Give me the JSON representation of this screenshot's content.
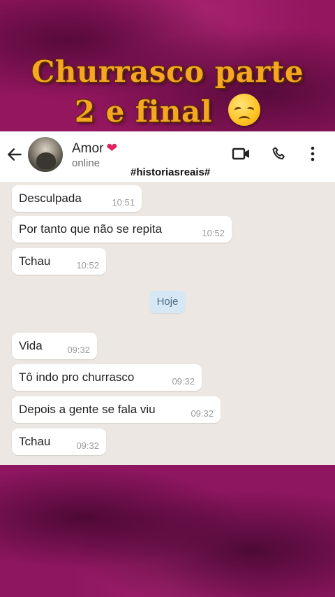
{
  "overlay": {
    "title_line1": "Churrasco parte",
    "title_line2": "2 e final",
    "title_emoji": "disappointed-face-emoji"
  },
  "header": {
    "contact_name": "Amor",
    "heart": "❤",
    "status": "online",
    "hashtag": "#historiasreais#",
    "icons": [
      "back-arrow-icon",
      "video-call-icon",
      "voice-call-icon",
      "more-options-icon"
    ]
  },
  "date_separator": "Hoje",
  "messages_before": [
    {
      "text": "Desculpada",
      "time": "10:51"
    },
    {
      "text": "Por tanto que não se repita",
      "time": "10:52"
    },
    {
      "text": "Tchau",
      "time": "10:52"
    }
  ],
  "messages_after": [
    {
      "text": "Vida",
      "time": "09:32"
    },
    {
      "text": "Tô indo pro churrasco",
      "time": "09:32"
    },
    {
      "text": "Depois a gente se fala viu",
      "time": "09:32"
    },
    {
      "text": "Tchau",
      "time": "09:32"
    }
  ],
  "colors": {
    "background": "#8a1860",
    "title": "#f5a623",
    "chat_bg": "#ece7e2",
    "bubble": "#ffffff",
    "date_chip": "#d6e8f6"
  }
}
